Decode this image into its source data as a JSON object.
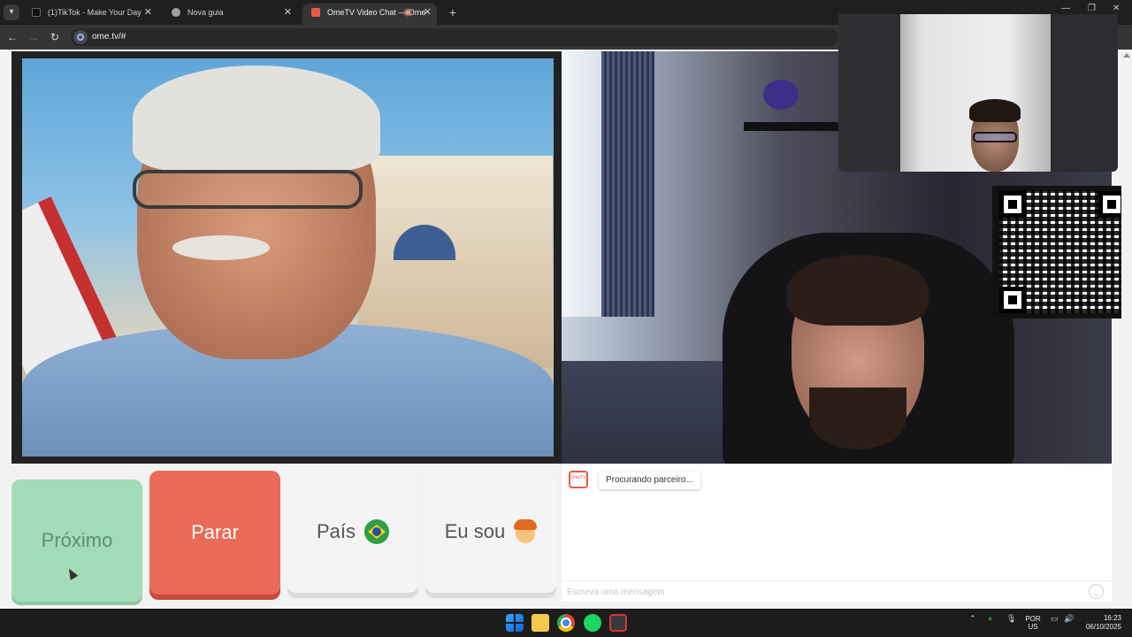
{
  "browser": {
    "tabs": [
      {
        "title": "(1)TikTok - Make Your Day",
        "favicon_color": "#111111",
        "active": false
      },
      {
        "title": "Nova guia",
        "favicon_color": "#9aa0a6",
        "active": false
      },
      {
        "title": "OmeTV Video Chat — Ome",
        "favicon_color": "#e95a4a",
        "active": true
      }
    ],
    "new_tab_label": "+",
    "url": "ome.tv/#"
  },
  "controls": {
    "next_label": "Próximo",
    "stop_label": "Parar",
    "country_label": "País",
    "gender_label": "Eu sou"
  },
  "chat": {
    "status_message": "Procurando parceiro...",
    "input_placeholder": "Escreva uma mensagem"
  },
  "taskbar": {
    "language_line1": "POR",
    "language_line2": "US",
    "time": "16:23",
    "date": "06/10/2025"
  },
  "colors": {
    "next_button": "#a3dbb6",
    "stop_button": "#e96b57",
    "accent_logo": "#e95a4a"
  }
}
